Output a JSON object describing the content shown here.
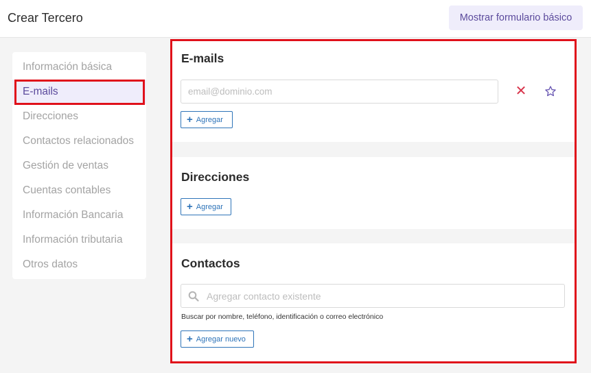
{
  "header": {
    "title": "Crear Tercero",
    "basic_form_button": "Mostrar formulario básico"
  },
  "sidebar": {
    "items": [
      {
        "label": "Información básica"
      },
      {
        "label": "E-mails",
        "active": true
      },
      {
        "label": "Direcciones"
      },
      {
        "label": "Contactos relacionados"
      },
      {
        "label": "Gestión de ventas"
      },
      {
        "label": "Cuentas contables"
      },
      {
        "label": "Información Bancaria"
      },
      {
        "label": "Información tributaria"
      },
      {
        "label": "Otros datos"
      }
    ]
  },
  "emails": {
    "title": "E-mails",
    "input_placeholder": "email@dominio.com",
    "input_value": "",
    "remove_icon": "close-icon",
    "favorite_icon": "star-icon",
    "add_label": "Agregar"
  },
  "addresses": {
    "title": "Direcciones",
    "add_label": "Agregar"
  },
  "contacts": {
    "title": "Contactos",
    "search_placeholder": "Agregar contacto existente",
    "search_icon": "search-icon",
    "hint": "Buscar por nombre, teléfono, identificación o correo electrónico",
    "add_new_label": "Agregar nuevo"
  },
  "colors": {
    "accent_purple": "#5b4a9c",
    "link_blue": "#2d73b8",
    "remove_red": "#d8334a",
    "highlight_red": "#e0101a"
  }
}
